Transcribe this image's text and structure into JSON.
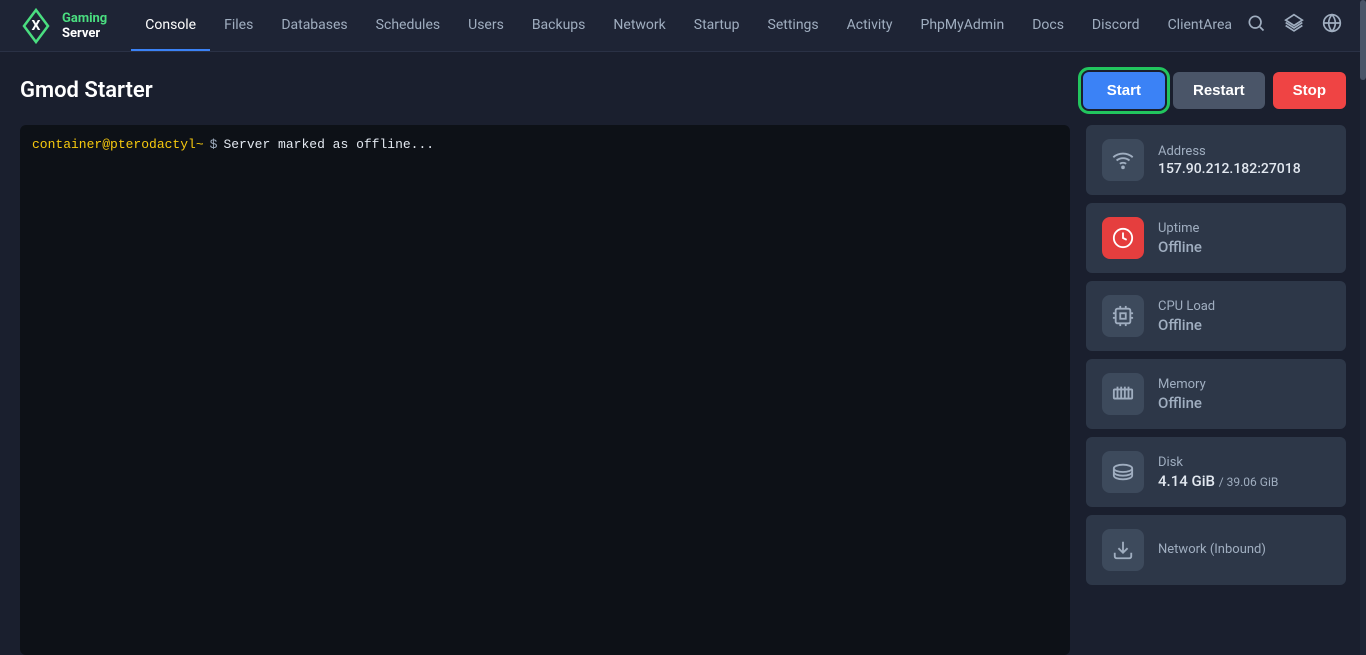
{
  "header": {
    "logo_line1": "Gaming",
    "logo_line2": "Server",
    "icons": {
      "search": "🔍",
      "layers": "⧉",
      "globe": "🌐",
      "forward": "⇥"
    }
  },
  "nav": {
    "items": [
      {
        "id": "console",
        "label": "Console",
        "active": true
      },
      {
        "id": "files",
        "label": "Files",
        "active": false
      },
      {
        "id": "databases",
        "label": "Databases",
        "active": false
      },
      {
        "id": "schedules",
        "label": "Schedules",
        "active": false
      },
      {
        "id": "users",
        "label": "Users",
        "active": false
      },
      {
        "id": "backups",
        "label": "Backups",
        "active": false
      },
      {
        "id": "network",
        "label": "Network",
        "active": false
      },
      {
        "id": "startup",
        "label": "Startup",
        "active": false
      },
      {
        "id": "settings",
        "label": "Settings",
        "active": false
      },
      {
        "id": "activity",
        "label": "Activity",
        "active": false
      },
      {
        "id": "phpmyadmin",
        "label": "PhpMyAdmin",
        "active": false
      },
      {
        "id": "docs",
        "label": "Docs",
        "active": false
      },
      {
        "id": "discord",
        "label": "Discord",
        "active": false
      },
      {
        "id": "clientarea",
        "label": "ClientArea",
        "active": false
      }
    ]
  },
  "page": {
    "title": "Gmod Starter",
    "buttons": {
      "start": "Start",
      "restart": "Restart",
      "stop": "Stop"
    }
  },
  "console": {
    "line": {
      "prompt": "container@pterodactyl~",
      "separator": "$",
      "text": "Server marked as offline..."
    }
  },
  "stats": [
    {
      "id": "address",
      "label": "Address",
      "value": "157.90.212.182:27018",
      "icon": "wifi",
      "icon_color": "gray",
      "value_type": "address"
    },
    {
      "id": "uptime",
      "label": "Uptime",
      "value": "Offline",
      "icon": "clock",
      "icon_color": "red",
      "value_type": "offline"
    },
    {
      "id": "cpu",
      "label": "CPU Load",
      "value": "Offline",
      "icon": "cpu",
      "icon_color": "gray",
      "value_type": "offline"
    },
    {
      "id": "memory",
      "label": "Memory",
      "value": "Offline",
      "icon": "memory",
      "icon_color": "gray",
      "value_type": "offline"
    },
    {
      "id": "disk",
      "label": "Disk",
      "value": "4.14 GiB",
      "value_suffix": " / 39.06 GiB",
      "icon": "disk",
      "icon_color": "gray",
      "value_type": "disk"
    },
    {
      "id": "network",
      "label": "Network (Inbound)",
      "value": "",
      "icon": "download",
      "icon_color": "gray",
      "value_type": "normal"
    }
  ]
}
